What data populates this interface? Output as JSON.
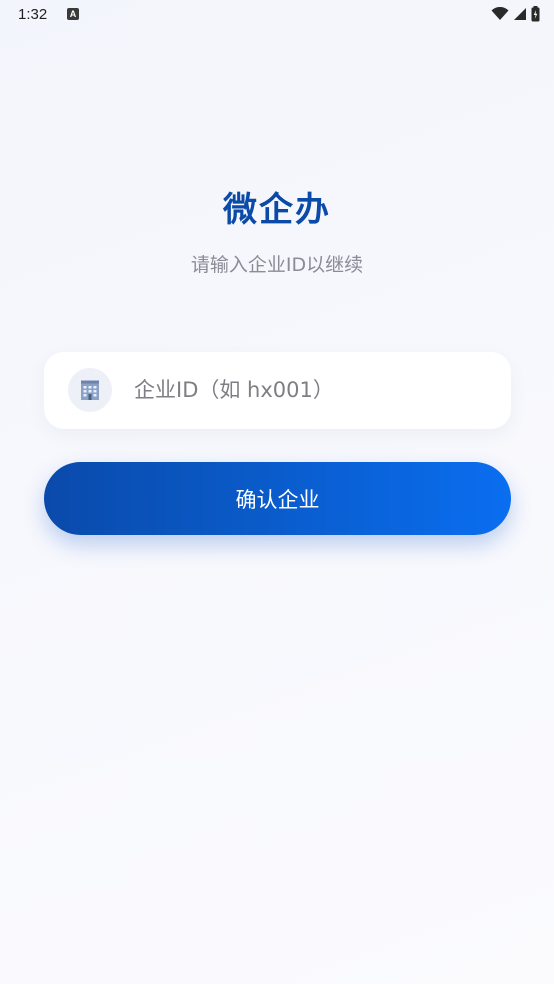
{
  "status_bar": {
    "time": "1:32",
    "notification_icon": "a-letter-icon",
    "icons": [
      "wifi-icon",
      "signal-icon",
      "battery-icon"
    ]
  },
  "app": {
    "title": "微企办",
    "subtitle": "请输入企业ID以继续"
  },
  "form": {
    "enterprise_id": {
      "icon": "office-building-icon",
      "value": "",
      "placeholder": "企业ID（如 hx001）"
    },
    "confirm_label": "确认企业"
  },
  "colors": {
    "brand": "#0a4aa8",
    "button_start": "#0a4aab",
    "button_end": "#0a6ef0",
    "subtitle": "#8a8d96",
    "background": "#f5f6fc"
  }
}
